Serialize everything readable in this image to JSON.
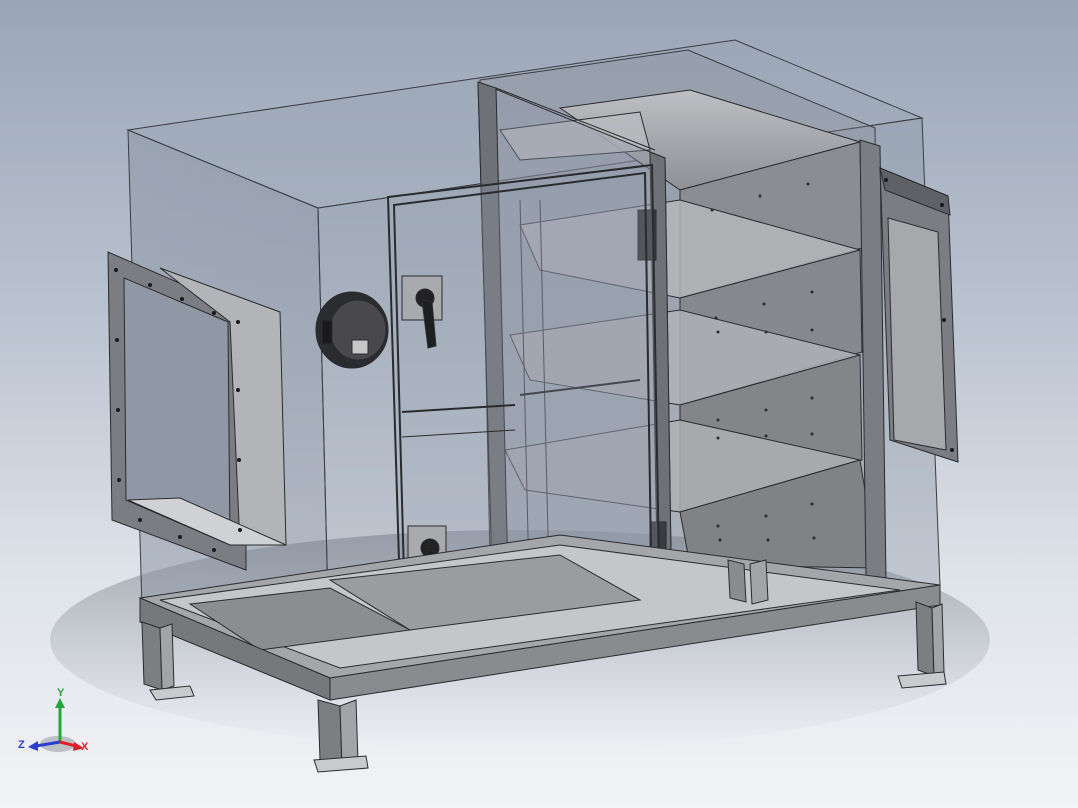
{
  "viewport": {
    "background_top": "#9aa6b8",
    "background_bottom": "#f2f3f6",
    "model_colors": {
      "steel": "#7f8186",
      "steel_light": "#a9abb0",
      "steel_dark": "#55575b",
      "glass": "#8a95a4",
      "edge": "#2a2b2e"
    }
  },
  "triad": {
    "x_label": "X",
    "y_label": "Y",
    "z_label": "Z",
    "x_color": "#e0202a",
    "y_color": "#22a83a",
    "z_color": "#2a3fd0"
  }
}
